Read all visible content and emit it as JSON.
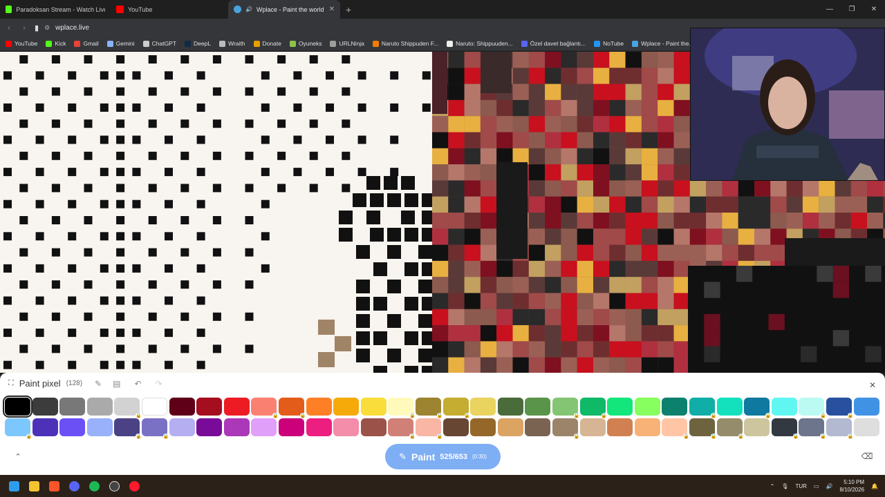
{
  "browser": {
    "tabs": [
      {
        "title": "Paradoksan Stream - Watch Live on K",
        "color": "#53fc18",
        "active": false
      },
      {
        "title": "YouTube",
        "color": "#ff0000",
        "active": false
      },
      {
        "title": "Wplace - Paint the world",
        "color": "#4aa3df",
        "active": true
      }
    ],
    "new_tab": "+",
    "window_controls": {
      "minimize": "—",
      "maximize": "❐",
      "close": "✕"
    },
    "url": "wplace.live",
    "bookmarks": [
      {
        "label": "YouTube",
        "color": "#ff0000"
      },
      {
        "label": "Kick",
        "color": "#53fc18"
      },
      {
        "label": "Gmail",
        "color": "#ea4335"
      },
      {
        "label": "Gemini",
        "color": "#8ab4f8"
      },
      {
        "label": "ChatGPT",
        "color": "#cccccc"
      },
      {
        "label": "DeepL",
        "color": "#0f2b46"
      },
      {
        "label": "Wraith",
        "color": "#bbbbbb"
      },
      {
        "label": "Donate",
        "color": "#e5a000"
      },
      {
        "label": "Oyuneks",
        "color": "#8bc34a"
      },
      {
        "label": "URLNinja",
        "color": "#9e9e9e"
      },
      {
        "label": "Naruto Shippuden F...",
        "color": "#f57c00"
      },
      {
        "label": "Naruto: Shippuuden...",
        "color": "#eeeeee"
      },
      {
        "label": "Özel davet bağlantı...",
        "color": "#5865f2"
      },
      {
        "label": "NoTube",
        "color": "#2196f3"
      },
      {
        "label": "Wplace - Paint the...",
        "color": "#4aa3df"
      }
    ]
  },
  "panel": {
    "title": "Paint pixel",
    "count": "(128)",
    "close": "✕",
    "expand_icon": "⌃",
    "palette_row1": [
      "#000000",
      "#3c3c3c",
      "#787878",
      "#aaaaaa",
      "#d2d2d2",
      "#ffffff",
      "#600018",
      "#a50e1e",
      "#ed1c24",
      "#fa8072",
      "#e45c1a",
      "#ff7f27",
      "#f6aa09",
      "#f9dd3b",
      "#fffabc",
      "#9c8431",
      "#c5ad31",
      "#e8d45f",
      "#4a6b3a",
      "#5a944a",
      "#84c573",
      "#0eb968",
      "#13e67b",
      "#87ff5e",
      "#0c816e",
      "#10aea6",
      "#13e1be",
      "#0f799f",
      "#60f7f2",
      "#bbfaf2",
      "#28509e",
      "#4093e4"
    ],
    "palette_row2": [
      "#7dc7ff",
      "#4d31b8",
      "#6b50f6",
      "#99b1fb",
      "#4a4284",
      "#7a71c4",
      "#b5aef1",
      "#780c99",
      "#aa38b9",
      "#e09ff9",
      "#cb007a",
      "#ec1f80",
      "#f38da9",
      "#9b5249",
      "#d18078",
      "#fab6a4",
      "#684634",
      "#95682a",
      "#dba463",
      "#7b6352",
      "#9c846b",
      "#d6b594",
      "#d18051",
      "#f8b277",
      "#ffc5a5",
      "#6d643f",
      "#948c6b",
      "#cdc59e",
      "#333941",
      "#6d758d",
      "#b3b9d1",
      "#dedede"
    ],
    "selected_index": 0,
    "paint_button": {
      "label": "Paint",
      "count": "525/653",
      "timer": "(0:30)"
    }
  },
  "taskbar": {
    "tray": {
      "lang": "TUR",
      "time": "5:10 PM",
      "date": "8/10/2026"
    }
  }
}
